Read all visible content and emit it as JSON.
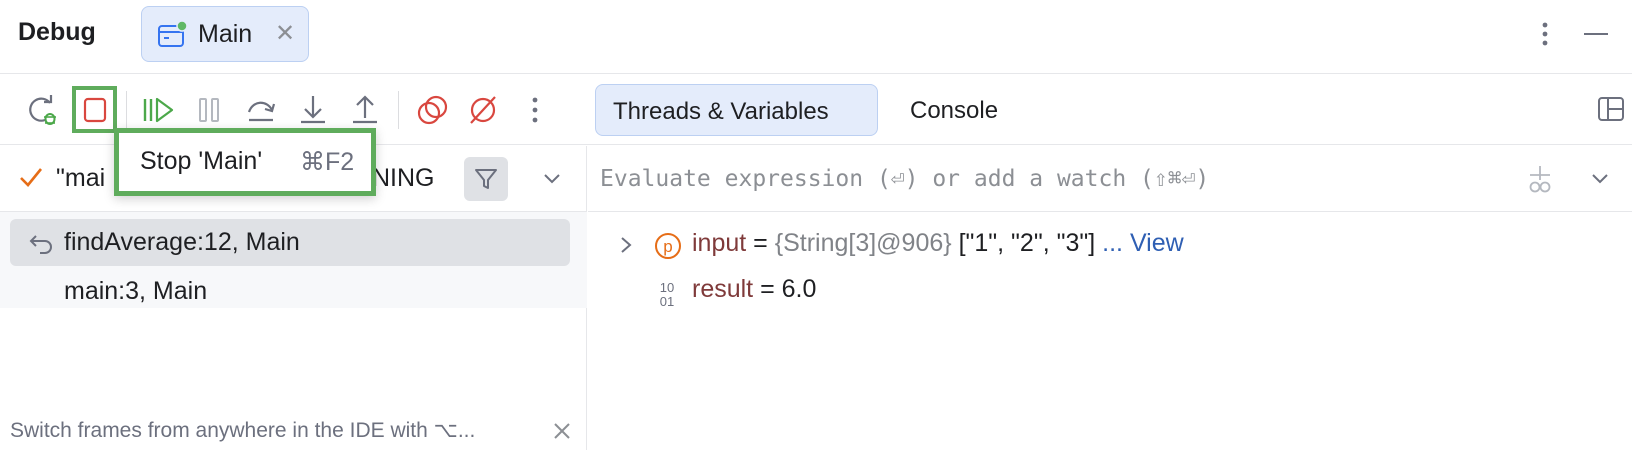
{
  "header": {
    "title": "Debug",
    "tab_label": "Main"
  },
  "toolbar": {
    "buttons": [
      "rerun-debug",
      "stop",
      "resume",
      "pause",
      "step-over",
      "step-into",
      "step-out",
      "view-breakpoints",
      "mute-breakpoints",
      "more"
    ],
    "stop_color": "#d9473f",
    "resume_color": "#4ca84a",
    "tabs": {
      "threads_variables": "Threads & Variables",
      "console": "Console"
    }
  },
  "tooltip": {
    "label": "Stop 'Main'",
    "shortcut": "⌘F2"
  },
  "threads": {
    "selected_thread_visible": "\"mai",
    "status_visible": "NING"
  },
  "frames": [
    {
      "label": "findAverage:12, Main"
    },
    {
      "label": "main:3, Main"
    }
  ],
  "hint": {
    "text": "Switch frames from anywhere in the IDE with ⌥..."
  },
  "evaluate": {
    "placeholder": "Evaluate expression (⏎) or add a watch (⇧⌘⏎)"
  },
  "variables": [
    {
      "name": "input",
      "equals": " = ",
      "type": "{String[3]@906}",
      "value": " [\"1\", \"2\", \"3\"] ",
      "link": "... View",
      "icon": "parameter-icon"
    },
    {
      "name": "result",
      "equals": " = ",
      "value": "6.0",
      "icon": "primitive-icon"
    }
  ],
  "colors": {
    "accent_tab_bg": "#e4ecfb",
    "highlight_green": "#5fac5c",
    "link_blue": "#2f5fb3",
    "var_name": "#7f3a3a"
  }
}
